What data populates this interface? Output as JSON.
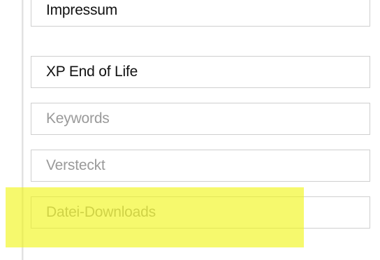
{
  "fields": [
    {
      "name": "impressum",
      "value": "Impressum",
      "placeholder": ""
    },
    {
      "name": "xp-end-of-life",
      "value": "XP End of Life",
      "placeholder": ""
    },
    {
      "name": "keywords",
      "value": "",
      "placeholder": "Keywords"
    },
    {
      "name": "versteckt",
      "value": "",
      "placeholder": "Versteckt"
    },
    {
      "name": "datei-downloads",
      "value": "",
      "placeholder": "Datei-Downloads"
    }
  ],
  "colors": {
    "highlight": "#f0f514",
    "field_border": "#cfcfcf",
    "placeholder_text": "#9a9a9a",
    "value_text": "#111111"
  }
}
